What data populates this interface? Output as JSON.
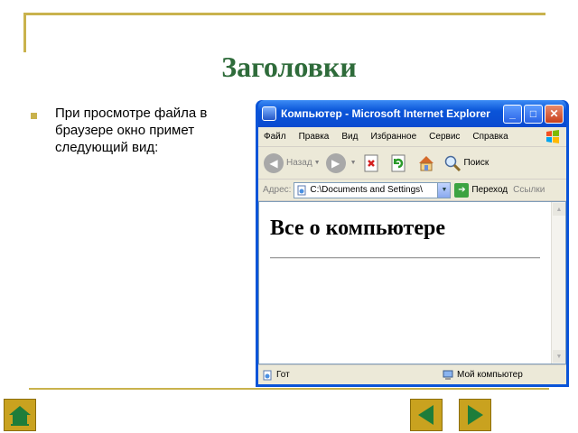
{
  "slide": {
    "title": "Заголовки",
    "bullet": "При просмотре файла в браузере окно примет следующий вид:"
  },
  "browser": {
    "window_title": "Компьютер - Microsoft Internet Explorer",
    "menu": [
      "Файл",
      "Правка",
      "Вид",
      "Избранное",
      "Сервис",
      "Справка"
    ],
    "toolbar": {
      "back_label": "Назад",
      "search_label": "Поиск"
    },
    "address": {
      "label": "Адрес:",
      "value": "C:\\Documents and Settings\\",
      "go_label": "Переход",
      "links_label": "Ссылки"
    },
    "page": {
      "heading": "Все о компьютере"
    },
    "status": {
      "left": "Гот",
      "right": "Мой компьютер"
    }
  },
  "colors": {
    "title_green": "#2e6b3a",
    "accent_gold": "#c9b24d",
    "xp_blue": "#0a54d8",
    "nav_button": "#c9a21f"
  },
  "icons": [
    "ie-icon",
    "minimize-icon",
    "maximize-icon",
    "close-icon",
    "windows-logo-icon",
    "back-icon",
    "forward-icon",
    "stop-icon",
    "refresh-icon",
    "home-icon",
    "search-icon",
    "go-icon",
    "page-icon",
    "computer-icon",
    "slide-home-icon",
    "prev-arrow-icon",
    "next-arrow-icon"
  ]
}
